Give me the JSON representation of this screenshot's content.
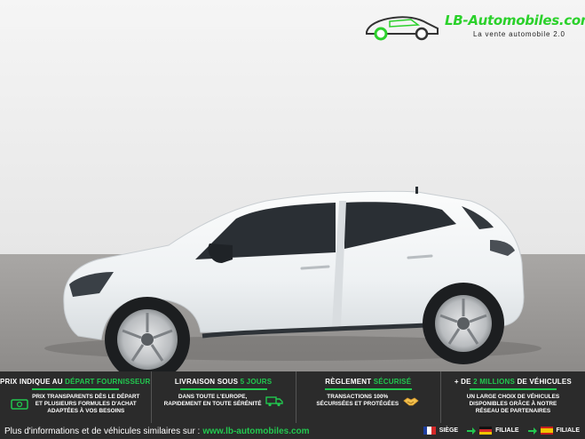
{
  "brand": {
    "name": "LB-Automobiles.com",
    "tagline": "La vente automobile 2.0",
    "accent_color": "#22c84f"
  },
  "photo": {
    "subject": "white-compact-hatchback",
    "car_color": "#f3f5f6",
    "backdrop_color": "#f2f2f2",
    "floor_color": "#9c9a98"
  },
  "banner": {
    "columns": [
      {
        "title_plain": "PRIX INDIQUE AU ",
        "title_highlight": "DÉPART FOURNISSEUR",
        "title_suffix": "",
        "text": "PRIX TRANSPARENTS DÈS LE DÉPART\nET PLUSIEURS FORMULES D'ACHAT\nADAPTÉES À VOS BESOINS",
        "icon": "banknote-icon"
      },
      {
        "title_plain": "LIVRAISON SOUS ",
        "title_highlight": "5 JOURS",
        "title_suffix": "",
        "text": "DANS TOUTE L'EUROPE,\nRAPIDEMENT EN TOUTE SÉRÉNITÉ",
        "icon": "delivery-truck-icon"
      },
      {
        "title_plain": "RÈGLEMENT ",
        "title_highlight": "SÉCURISÉ",
        "title_suffix": "",
        "text": "TRANSACTIONS 100%\nSÉCURISÉES ET PROTÉGÉES",
        "icon": "handshake-icon"
      },
      {
        "title_plain": "+ DE ",
        "title_highlight": "2 MILLIONS",
        "title_suffix": " DE VÉHICULES",
        "text": "UN LARGE CHOIX DE VÉHICULES\nDISPONIBLES GRÂCE À NOTRE\nRÉSEAU DE PARTENAIRES",
        "icon": ""
      }
    ],
    "footer_text": "Plus d'informations et de véhicules similaires sur :",
    "footer_link": "www.lb-automobiles.com",
    "sites": [
      {
        "label": "SIÈGE",
        "flag": "france-flag-icon"
      },
      {
        "label": "FILIALE",
        "flag": "germany-flag-icon"
      },
      {
        "label": "FILIALE",
        "flag": "spain-flag-icon"
      }
    ]
  }
}
